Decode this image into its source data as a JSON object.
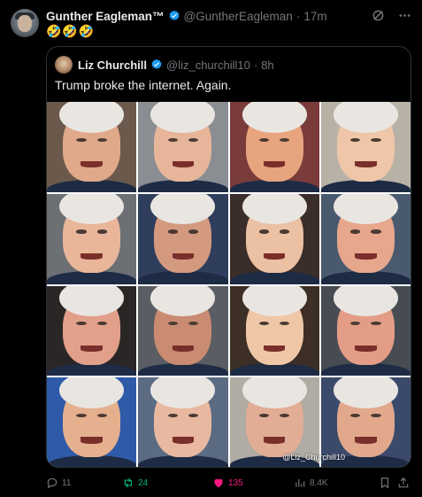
{
  "post": {
    "author_name": "Gunther Eagleman™",
    "author_handle": "@GuntherEagleman",
    "separator": "·",
    "time": "17m",
    "text": "🤣🤣🤣"
  },
  "quote": {
    "author_name": "Liz Churchill",
    "author_handle": "@liz_churchill10",
    "separator": "·",
    "time": "8h",
    "text": "Trump broke the internet. Again.",
    "image_watermark": "@Liz_Churchill10"
  },
  "actions": {
    "replies": "11",
    "reposts": "24",
    "likes": "135",
    "views": "8.4K"
  },
  "colors": {
    "verified": "#1d9bf0",
    "repost_active": "#00ba7c",
    "like_active": "#f91880",
    "muted": "#71767b"
  },
  "icons": [
    "grok-icon",
    "more-icon",
    "reply-icon",
    "repost-icon",
    "like-icon",
    "views-icon",
    "bookmark-icon",
    "share-icon",
    "verified-badge-icon"
  ]
}
